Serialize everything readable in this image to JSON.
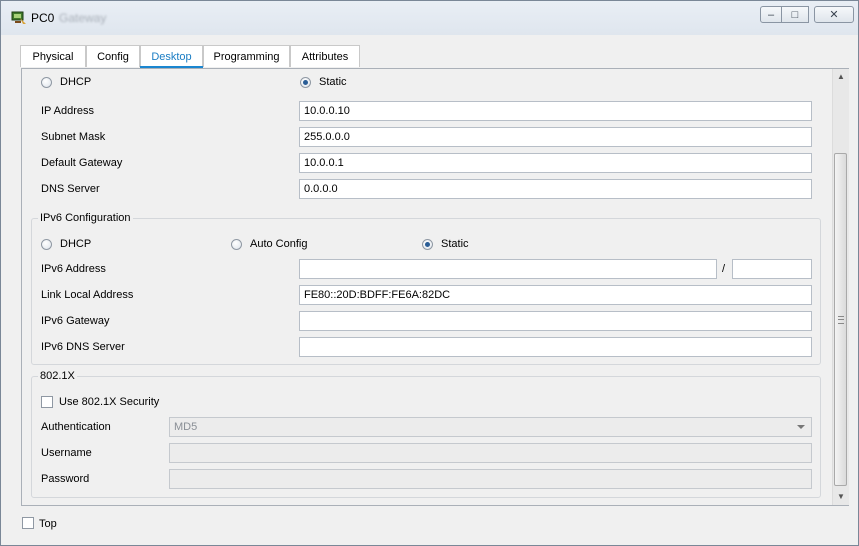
{
  "window": {
    "title": "PC0",
    "title_ghost": "Gateway",
    "controls": {
      "minimize": "–",
      "maximize": "□",
      "close": "✕"
    }
  },
  "tabs": [
    {
      "label": "Physical"
    },
    {
      "label": "Config"
    },
    {
      "label": "Desktop"
    },
    {
      "label": "Programming"
    },
    {
      "label": "Attributes"
    }
  ],
  "ipv4": {
    "dhcp_label": "DHCP",
    "static_label": "Static",
    "mode": "static",
    "ip_address": {
      "label": "IP Address",
      "value": "10.0.0.10"
    },
    "subnet_mask": {
      "label": "Subnet Mask",
      "value": "255.0.0.0"
    },
    "default_gateway": {
      "label": "Default Gateway",
      "value": "10.0.0.1"
    },
    "dns_server": {
      "label": "DNS Server",
      "value": "0.0.0.0"
    }
  },
  "ipv6": {
    "title": "IPv6 Configuration",
    "dhcp_label": "DHCP",
    "auto_label": "Auto Config",
    "static_label": "Static",
    "mode": "static",
    "address": {
      "label": "IPv6 Address",
      "value": "",
      "prefix": "",
      "separator": "/"
    },
    "link_local": {
      "label": "Link Local Address",
      "value": "FE80::20D:BDFF:FE6A:82DC"
    },
    "gateway": {
      "label": "IPv6 Gateway",
      "value": ""
    },
    "dns": {
      "label": "IPv6 DNS Server",
      "value": ""
    }
  },
  "dot1x": {
    "title": "802.1X",
    "use_security_label": "Use 802.1X Security",
    "use_security_checked": false,
    "authentication": {
      "label": "Authentication",
      "value": "MD5"
    },
    "username": {
      "label": "Username",
      "value": ""
    },
    "password": {
      "label": "Password",
      "value": ""
    }
  },
  "footer": {
    "top_label": "Top",
    "top_checked": false
  },
  "icons": {
    "app": "packet-tracer-pc-icon",
    "scroll_up": "▲",
    "scroll_down": "▼"
  }
}
